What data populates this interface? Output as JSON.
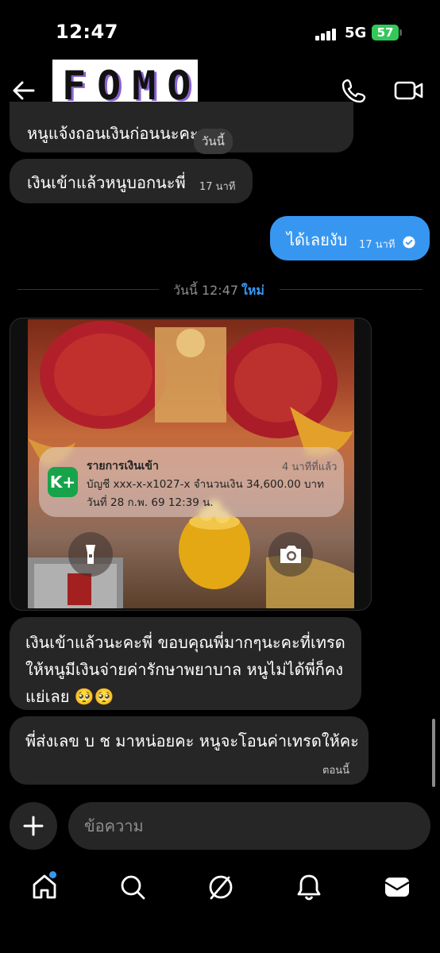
{
  "status": {
    "time": "12:47",
    "network": "5G",
    "battery": "57"
  },
  "header": {
    "title": "FOMO"
  },
  "messages": [
    {
      "text": "หนูแจ้งถอนเงินก่อนนะคะ",
      "time": "วันนี้"
    },
    {
      "text": "เงินเข้าแล้วหนูบอกนะพี่",
      "time": "17 นาที"
    },
    {
      "text": "ได้เลยงับ",
      "time": "17 นาที"
    }
  ],
  "divider": {
    "date": "วันนี้ 12:47",
    "new_label": "ใหม่"
  },
  "image_notification": {
    "app_icon": "K+",
    "title": "รายการเงินเข้า",
    "time": "4 นาทีที่แล้ว",
    "line1": "บัญชี xxx-x-x1027-x  จำนวนเงิน 34,600.00 บาท",
    "line2": "วันที่ 28 ก.พ. 69  12:39 น."
  },
  "bottom_messages": [
    {
      "text": "เงินเข้าแล้วนะคะพี่ ขอบคุณพี่มากๆนะคะที่เทรดให้หนูมีเงินจ่ายค่ารักษาพยาบาล หนูไม่ได้พี่ก็คงแย่เลย 🥺🥺"
    },
    {
      "text": "พี่ส่งเลข บ ช มาหน่อยคะ หนูจะโอนค่าเทรดให้คะ",
      "time": "ตอนนี้"
    }
  ],
  "composer": {
    "placeholder": "ข้อความ"
  },
  "colors": {
    "accent": "#3797f0",
    "bubble": "#262626",
    "kplus": "#17a34a",
    "battery": "#34c759"
  },
  "icons": [
    "back-arrow-icon",
    "phone-icon",
    "video-icon",
    "flashlight-icon",
    "camera-icon",
    "plus-icon",
    "home-icon",
    "search-icon",
    "explore-icon",
    "bell-icon",
    "inbox-icon"
  ]
}
